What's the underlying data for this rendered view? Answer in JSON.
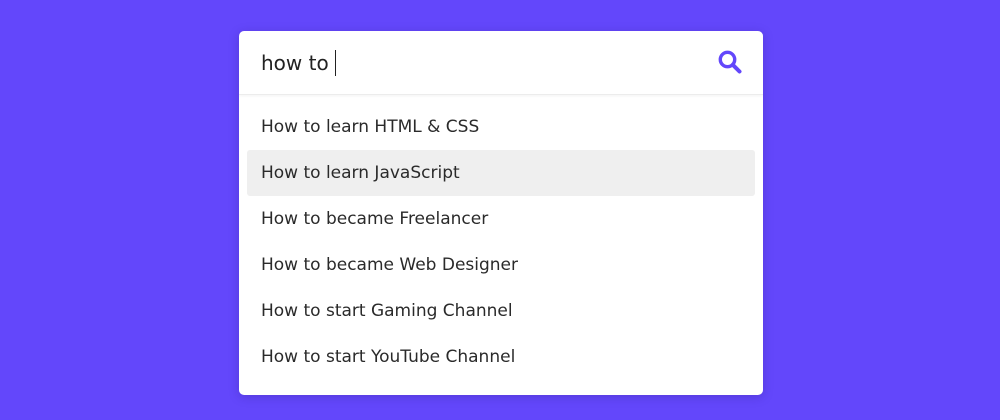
{
  "search": {
    "value": "how to",
    "icon": "search-icon"
  },
  "suggestions": [
    "How to learn HTML & CSS",
    "How to learn JavaScript",
    "How to became Freelancer",
    "How to became Web Designer",
    "How to start Gaming Channel",
    "How to start YouTube Channel"
  ],
  "highlighted_index": 1,
  "colors": {
    "background": "#6347fb",
    "accent": "#6347fb",
    "highlight": "#efefef",
    "text": "#2a2a2a"
  }
}
